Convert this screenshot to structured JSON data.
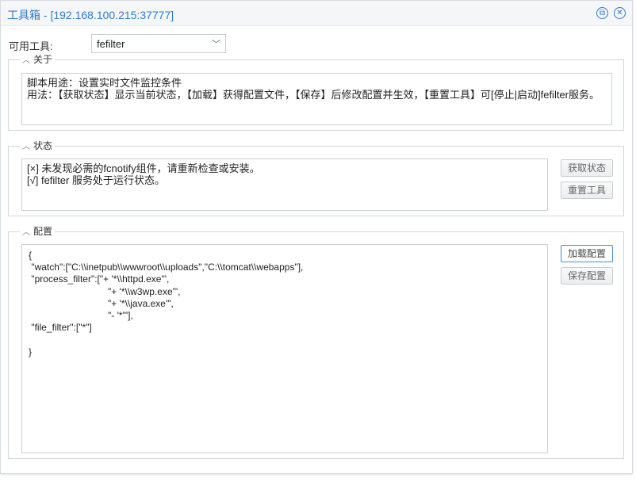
{
  "window": {
    "title": "工具箱 - [192.168.100.215:37777]",
    "restore_icon": "restore-icon",
    "close_icon": "close-icon",
    "accent_color": "#2e7bcf"
  },
  "tool_select": {
    "label": "可用工具:",
    "value": "fefilter"
  },
  "about": {
    "legend": "关于",
    "line1": "脚本用途：设置实时文件监控条件",
    "line2": "用法：【获取状态】显示当前状态，【加载】获得配置文件，【保存】后修改配置并生效，【重置工具】可[停止|启动]fefilter服务。"
  },
  "status": {
    "legend": "状态",
    "line1": "[×] 未发现必需的fcnotify组件，请重新检查或安装。",
    "line2": "[√] fefilter 服务处于运行状态。",
    "get_status_label": "获取状态",
    "reset_tool_label": "重置工具"
  },
  "config": {
    "legend": "配置",
    "content": "{\n \"watch\":[\"C:\\\\inetpub\\\\wwwroot\\\\uploads\",\"C:\\\\tomcat\\\\webapps\"],\n \"process_filter\":[\"+ '*\\\\httpd.exe'\",\n                              \"+ '*\\\\w3wp.exe'\",\n                              \"+ '*\\\\java.exe'\",\n                              \"- '*'\"],\n \"file_filter\":[\"*\"]\n\n}",
    "load_label": "加载配置",
    "save_label": "保存配置"
  }
}
